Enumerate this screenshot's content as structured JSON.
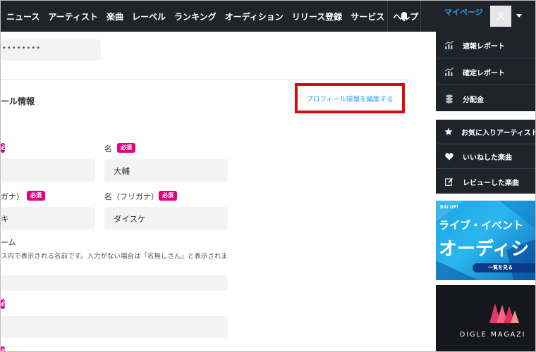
{
  "nav": {
    "items": [
      "ニュース",
      "アーティスト",
      "楽曲",
      "レーベル",
      "ランキング",
      "オーディション",
      "リリース登録",
      "サービス",
      "ヘルプ"
    ],
    "mypage": "マイページ"
  },
  "form": {
    "password_value": "••••••••",
    "section_title": "ール情報",
    "edit_link": "プロフィール情報を編集する",
    "labels": {
      "first_name": "名",
      "last_kana": "ガナ）",
      "first_kana": "名（フリガナ）",
      "nickname": "ーム"
    },
    "required": "必須",
    "values": {
      "first_name": "大輔",
      "last_kana": "キ",
      "first_kana": "ダイスケ"
    },
    "nickname_hint": "ス内で表示される名前です。入力がない場合は「名無しさん」と表示されま"
  },
  "sidebar": {
    "reports": [
      "速報レポート",
      "確定レポート",
      "分配金"
    ],
    "favorites": [
      "お気に入りアーティスト",
      "いいねした楽曲",
      "レビューした楽曲"
    ],
    "banner_audition": {
      "tag": "BIG UP!",
      "line1": "ライブ・イベント",
      "line2": "オーディシ",
      "button": "一覧を見る"
    },
    "banner_magazine": {
      "text": "DIGLE MAGAZI"
    }
  },
  "colors": {
    "nav_bg": "#1f232a",
    "accent": "#2f9fe6",
    "required": "#e4007f",
    "highlight": "#d70c0c"
  }
}
